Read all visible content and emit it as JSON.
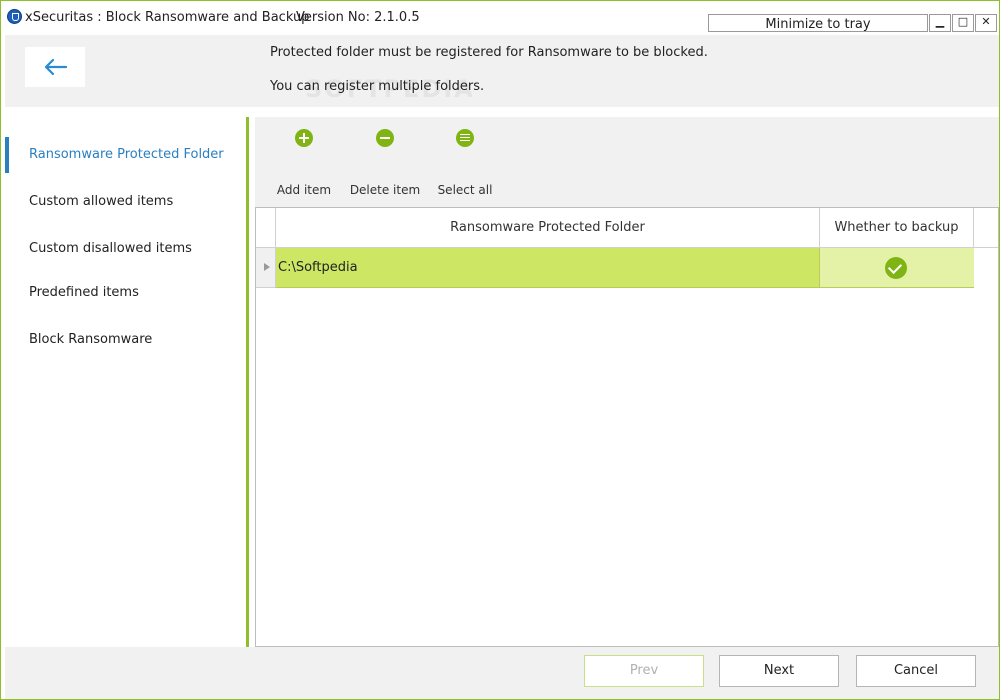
{
  "window": {
    "title": "xSecuritas : Block Ransomware and Backup",
    "version": "Version No: 2.1.0.5",
    "tray_label": "Minimize to tray",
    "min_glyph": "▁",
    "max_glyph": "□",
    "close_glyph": "✕"
  },
  "header": {
    "info_line1": "Protected folder must be registered for Ransomware to be blocked.",
    "info_line2": "You can register multiple folders.",
    "watermark": "SOFTPEDIA"
  },
  "sidebar": {
    "items": [
      {
        "label": "Ransomware Protected Folder",
        "active": true
      },
      {
        "label": "Custom allowed items",
        "active": false
      },
      {
        "label": "Custom disallowed items",
        "active": false
      },
      {
        "label": "Predefined items",
        "active": false
      },
      {
        "label": "Block Ransomware",
        "active": false
      }
    ]
  },
  "toolbar": {
    "add_label": "Add item",
    "delete_label": "Delete item",
    "select_all_label": "Select all"
  },
  "grid": {
    "columns": [
      "Ransomware Protected Folder",
      "Whether to backup"
    ],
    "rows": [
      {
        "folder": "C:\\Softpedia",
        "backup": true
      }
    ]
  },
  "footer": {
    "prev_label": "Prev",
    "next_label": "Next",
    "cancel_label": "Cancel"
  },
  "colors": {
    "accent_green": "#8cbf2a",
    "icon_green": "#7fb414",
    "row_highlight": "#cde764",
    "active_blue": "#2a7fc1"
  }
}
